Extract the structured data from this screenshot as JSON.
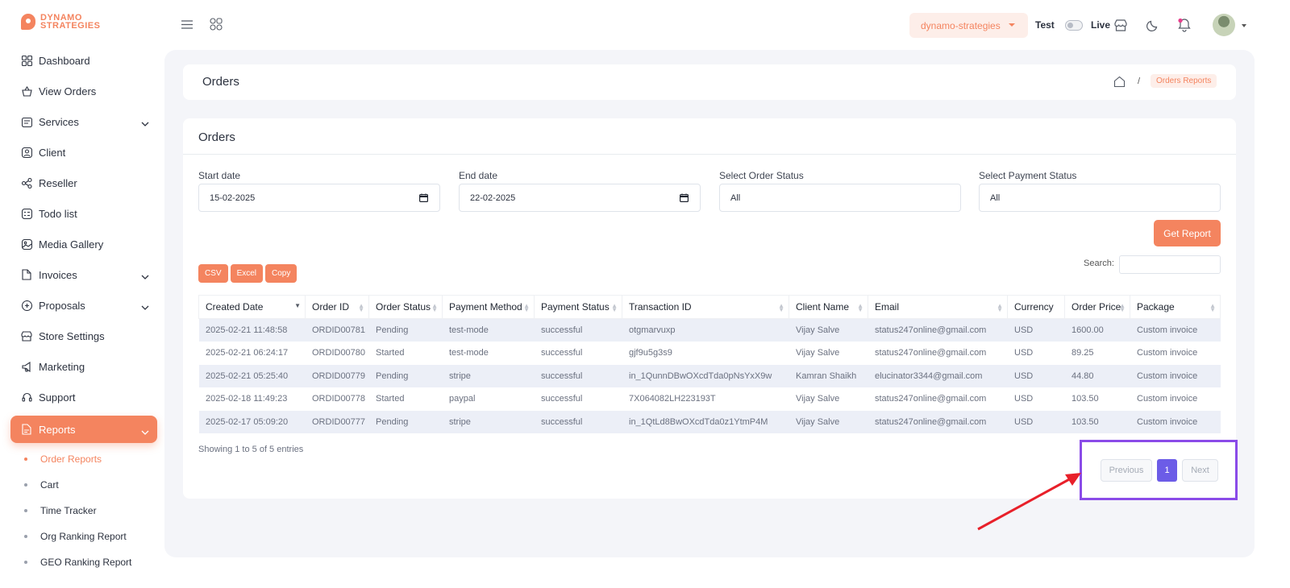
{
  "brand": {
    "line1": "DYNAMO",
    "line2": "STRATEGIES"
  },
  "sidebar": {
    "items": [
      {
        "label": "Dashboard",
        "icon": "dashboard-icon"
      },
      {
        "label": "View Orders",
        "icon": "basket-icon"
      },
      {
        "label": "Services",
        "icon": "calendar-icon",
        "expandable": true
      },
      {
        "label": "Client",
        "icon": "user-icon"
      },
      {
        "label": "Reseller",
        "icon": "network-icon"
      },
      {
        "label": "Todo list",
        "icon": "checklist-icon"
      },
      {
        "label": "Media Gallery",
        "icon": "image-icon"
      },
      {
        "label": "Invoices",
        "icon": "document-icon",
        "expandable": true
      },
      {
        "label": "Proposals",
        "icon": "proposal-icon",
        "expandable": true
      },
      {
        "label": "Store Settings",
        "icon": "store-icon"
      },
      {
        "label": "Marketing",
        "icon": "megaphone-icon"
      },
      {
        "label": "Support",
        "icon": "headset-icon"
      },
      {
        "label": "Reports",
        "icon": "report-icon",
        "expandable": true,
        "active": true
      }
    ],
    "sub_items": [
      {
        "label": "Order Reports",
        "active": true
      },
      {
        "label": "Cart"
      },
      {
        "label": "Time Tracker"
      },
      {
        "label": "Org Ranking Report"
      },
      {
        "label": "GEO Ranking Report"
      }
    ]
  },
  "header": {
    "store": "dynamo-strategies",
    "mode_test": "Test",
    "mode_live": "Live",
    "live_mode_enabled": false
  },
  "page": {
    "title": "Orders",
    "breadcrumb_current": "Orders Reports"
  },
  "card": {
    "title": "Orders",
    "filters": {
      "start_label": "Start date",
      "start_value": "15-02-2025",
      "end_label": "End date",
      "end_value": "22-02-2025",
      "order_status_label": "Select Order Status",
      "order_status_value": "All",
      "payment_status_label": "Select Payment Status",
      "payment_status_value": "All"
    },
    "get_report": "Get Report",
    "exports": [
      "CSV",
      "Excel",
      "Copy"
    ],
    "search_label": "Search:",
    "columns": [
      "Created Date",
      "Order ID",
      "Order Status",
      "Payment Method",
      "Payment Status",
      "Transaction ID",
      "Client Name",
      "Email",
      "Currency",
      "Order Price",
      "Package"
    ],
    "rows": [
      [
        "2025-02-21 11:48:58",
        "ORDID00781",
        "Pending",
        "test-mode",
        "successful",
        "otgmarvuxp",
        "Vijay Salve",
        "status247online@gmail.com",
        "USD",
        "1600.00",
        "Custom invoice"
      ],
      [
        "2025-02-21 06:24:17",
        "ORDID00780",
        "Started",
        "test-mode",
        "successful",
        "gjf9u5g3s9",
        "Vijay Salve",
        "status247online@gmail.com",
        "USD",
        "89.25",
        "Custom invoice"
      ],
      [
        "2025-02-21 05:25:40",
        "ORDID00779",
        "Pending",
        "stripe",
        "successful",
        "in_1QunnDBwOXcdTda0pNsYxX9w",
        "Kamran Shaikh",
        "elucinator3344@gmail.com",
        "USD",
        "44.80",
        "Custom invoice"
      ],
      [
        "2025-02-18 11:49:23",
        "ORDID00778",
        "Started",
        "paypal",
        "successful",
        "7X064082LH223193T",
        "Vijay Salve",
        "status247online@gmail.com",
        "USD",
        "103.50",
        "Custom invoice"
      ],
      [
        "2025-02-17 05:09:20",
        "ORDID00777",
        "Pending",
        "stripe",
        "successful",
        "in_1QtLd8BwOXcdTda0z1YtmP4M",
        "Vijay Salve",
        "status247online@gmail.com",
        "USD",
        "103.50",
        "Custom invoice"
      ]
    ],
    "info": "Showing 1 to 5 of 5 entries",
    "pager": {
      "prev": "Previous",
      "page": "1",
      "next": "Next"
    }
  },
  "colors": {
    "accent": "#f4845f",
    "pager_active": "#6c5ce7",
    "annotation": "#8a4be8",
    "arrow": "#e8202a"
  }
}
